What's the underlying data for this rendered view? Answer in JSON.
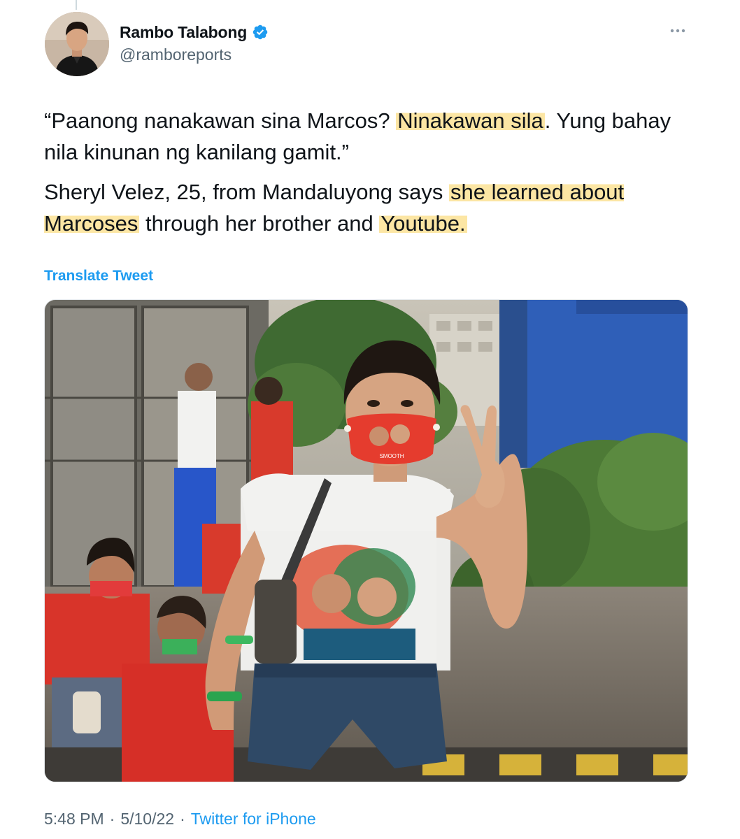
{
  "tweet": {
    "author": {
      "display_name": "Rambo Talabong",
      "handle": "@ramboreports",
      "verified_icon": "verified-badge-icon",
      "avatar_icon": "user-avatar"
    },
    "more_icon": "more-options-icon",
    "text": {
      "quote_part1": "“Paanong nanakawan sina Marcos? ",
      "quote_highlight": "Ninakawan sila",
      "quote_part2": ". Yung bahay nila kinunan ng kanilang gamit.”",
      "body_part1": "Sheryl Velez, 25, from Mandaluyong says ",
      "body_highlight1": "she learned about Marcoses",
      "body_part2": " through her brother and ",
      "body_highlight2": "Youtube."
    },
    "translate_label": "Translate Tweet",
    "media": {
      "photo_icon": "tweet-photo",
      "mask_text": "SMOOTH"
    },
    "meta": {
      "time": "5:48 PM",
      "separator": "·",
      "date": "5/10/22",
      "source": "Twitter for iPhone"
    }
  },
  "colors": {
    "link": "#1d9bf0",
    "secondary_text": "#536471",
    "highlight": "#fad66c",
    "verified": "#1d9bf0"
  }
}
